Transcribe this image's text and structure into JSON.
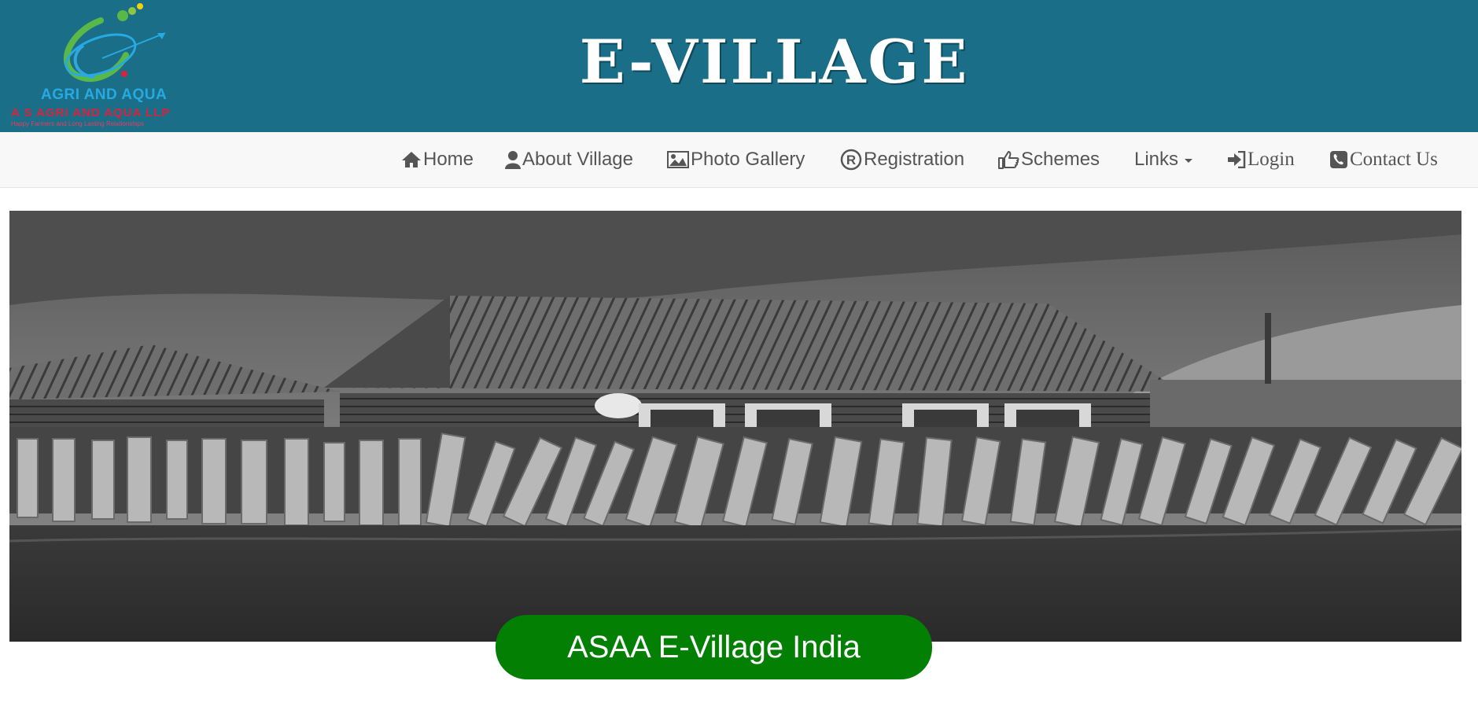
{
  "header": {
    "logo": {
      "line1": "AGRI AND AQUA",
      "line2": "A S AGRI AND AQUA LLP",
      "line3": "Happy Farmers and Long Lasting Relationships"
    },
    "title": "E-VILLAGE",
    "background_color": "#1b6e88"
  },
  "nav": {
    "items": [
      {
        "label": "Home",
        "icon": "home-icon"
      },
      {
        "label": "About Village",
        "icon": "user-icon"
      },
      {
        "label": "Photo Gallery",
        "icon": "picture-icon"
      },
      {
        "label": "Registration",
        "icon": "registered-icon"
      },
      {
        "label": "Schemes",
        "icon": "thumbs-up-icon"
      },
      {
        "label": "Links",
        "icon": "caret-down-icon"
      },
      {
        "label": "Login",
        "icon": "login-icon"
      },
      {
        "label": "Contact Us",
        "icon": "phone-icon"
      }
    ]
  },
  "hero": {
    "image": "black-and-white village house with wooden fence",
    "banner_text": "ASAA E-Village India",
    "banner_color": "#038003"
  }
}
